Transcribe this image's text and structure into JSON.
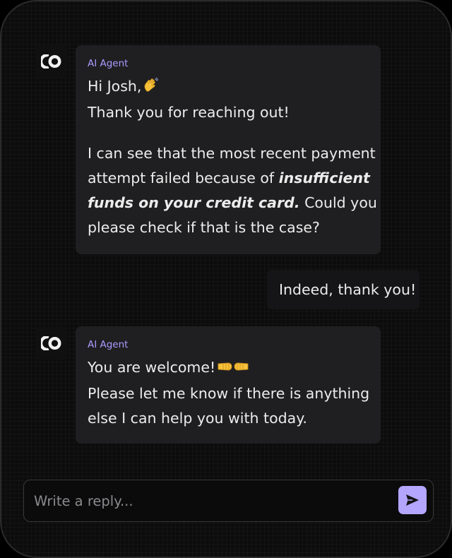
{
  "conversation": {
    "messages": [
      {
        "role": "agent",
        "sender": "AI Agent",
        "avatar_icon": "intercom-fin-logo-icon",
        "line1": "Hi Josh,",
        "line1_emoji": "waving-hand-emoji",
        "line2": "Thank you for reaching out!",
        "para2_line1": "I can see that the most recent payment",
        "para2_line2_prefix": "attempt failed because of ",
        "para2_line2_bold": "insufficient",
        "para2_line3_bold": "funds on your credit card.",
        "para2_line3_suffix": " Could you",
        "para2_line4": "please check if that is the case?"
      },
      {
        "role": "user",
        "text": "Indeed, thank you!"
      },
      {
        "role": "agent",
        "sender": "AI Agent",
        "avatar_icon": "intercom-fin-logo-icon",
        "line1": "You are welcome!",
        "line1_emoji": "fist-bump-emoji",
        "line2": "Please let me know if there is anything",
        "line3": "else I can help you with today."
      }
    ]
  },
  "composer": {
    "placeholder": "Write a reply...",
    "value": "",
    "send_icon": "send-arrow-icon"
  },
  "colors": {
    "accent": "#b4a6ff",
    "sender_label": "#a99cff",
    "agent_bubble": "#1f1f21",
    "user_bubble": "#151517",
    "background": "#0c0c0d"
  }
}
